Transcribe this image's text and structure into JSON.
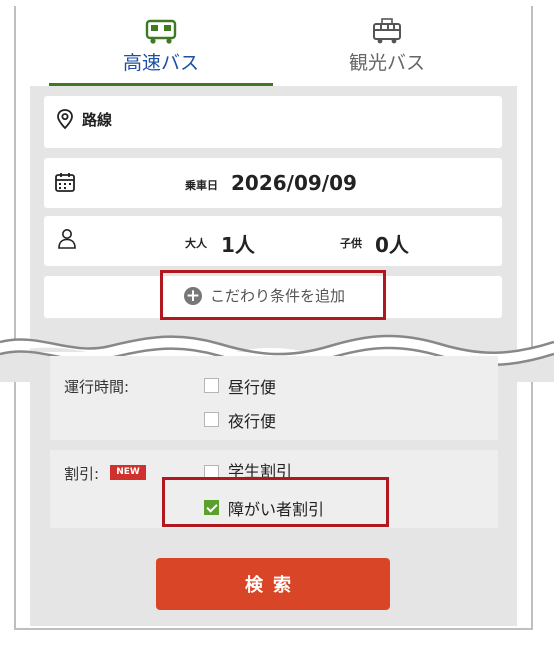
{
  "tabs": [
    {
      "label": "高速バス",
      "icon": "bus-icon",
      "active": true
    },
    {
      "label": "観光バス",
      "icon": "tour-bus-icon",
      "active": false
    }
  ],
  "route": {
    "label": "路線",
    "icon": "location-pin-icon"
  },
  "date": {
    "prefix": "乗車日",
    "value": "2026/09/09",
    "icon": "calendar-icon"
  },
  "passengers": {
    "icon": "person-icon",
    "adult_label": "大人",
    "adult_value": "1人",
    "child_label": "子供",
    "child_value": "0人"
  },
  "add_conditions": {
    "label": "こだわり条件を追加",
    "icon": "plus-circle-icon"
  },
  "operating_time": {
    "label": "運行時間:",
    "options": [
      {
        "label": "昼行便",
        "checked": false
      },
      {
        "label": "夜行便",
        "checked": false
      }
    ]
  },
  "discount": {
    "label": "割引:",
    "badge": "NEW",
    "options": [
      {
        "label": "学生割引",
        "checked": false
      },
      {
        "label": "障がい者割引",
        "checked": true
      }
    ]
  },
  "search_button": {
    "label": "検索"
  },
  "colors": {
    "accent_green": "#3f7a22",
    "search_red": "#d94627",
    "highlight_red": "#b0171f",
    "checkbox_green": "#5aa02c"
  }
}
